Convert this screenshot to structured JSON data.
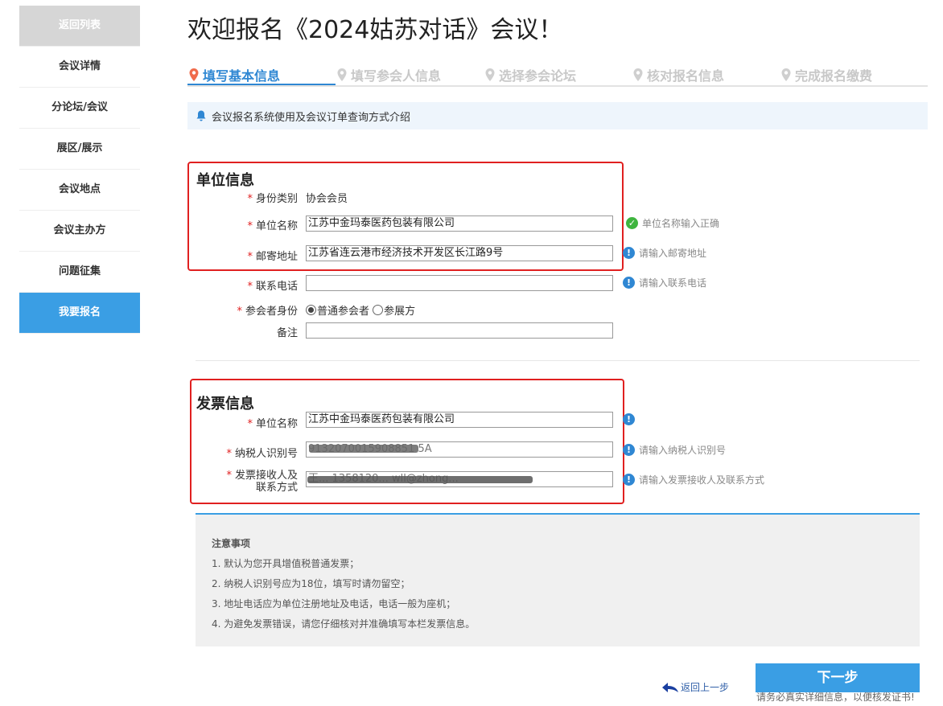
{
  "sidebar": {
    "items": [
      {
        "label": "返回列表"
      },
      {
        "label": "会议详情"
      },
      {
        "label": "分论坛/会议"
      },
      {
        "label": "展区/展示"
      },
      {
        "label": "会议地点"
      },
      {
        "label": "会议主办方"
      },
      {
        "label": "问题征集"
      },
      {
        "label": "我要报名"
      }
    ]
  },
  "page_title": "欢迎报名《2024姑苏对话》会议！",
  "steps": [
    {
      "label": "填写基本信息",
      "active": true
    },
    {
      "label": "填写参会人信息",
      "active": false
    },
    {
      "label": "选择参会论坛",
      "active": false
    },
    {
      "label": "核对报名信息",
      "active": false
    },
    {
      "label": "完成报名缴费",
      "active": false
    }
  ],
  "notice": "会议报名系统使用及会议订单查询方式介绍",
  "unit_section": {
    "title": "单位信息",
    "identity_label": "身份类别",
    "identity_value": "协会会员",
    "company_label": "单位名称",
    "company_value": "江苏中金玛泰医药包装有限公司",
    "company_hint": "单位名称输入正确",
    "address_label": "邮寄地址",
    "address_value": "江苏省连云港市经济技术开发区长江路9号",
    "address_hint": "请输入邮寄地址",
    "phone_label": "联系电话",
    "phone_value": "",
    "phone_hint": "请输入联系电话",
    "role_label": "参会者身份",
    "role_options": [
      "普通参会者",
      "参展方"
    ],
    "remark_label": "备注",
    "remark_value": ""
  },
  "invoice_section": {
    "title": "发票信息",
    "company_label": "单位名称",
    "company_value": "江苏中金玛泰医药包装有限公司",
    "taxid_label": "纳税人识别号",
    "taxid_value": "9132070015908851 5A",
    "taxid_hint": "请输入纳税人识别号",
    "receiver_label_1": "发票接收人及",
    "receiver_label_2": "联系方式",
    "receiver_value": "王... 1358120...   wll@zhong...",
    "receiver_hint": "请输入发票接收人及联系方式"
  },
  "notes": {
    "title": "注意事项",
    "items": [
      "1. 默认为您开具增值税普通发票；",
      "2. 纳税人识别号应为18位，填写时请勿留空；",
      "3. 地址电话应为单位注册地址及电话，电话一般为座机；",
      "4. 为避免发票错误，请您仔细核对并准确填写本栏发票信息。"
    ]
  },
  "actions": {
    "back_label": "返回上一步",
    "next_label": "下一步",
    "next_note": "请务必真实详细信息，以便核发证书!"
  },
  "colors": {
    "accent": "#3a9ee4",
    "error_box": "#e02020",
    "ok": "#3fb53f"
  }
}
